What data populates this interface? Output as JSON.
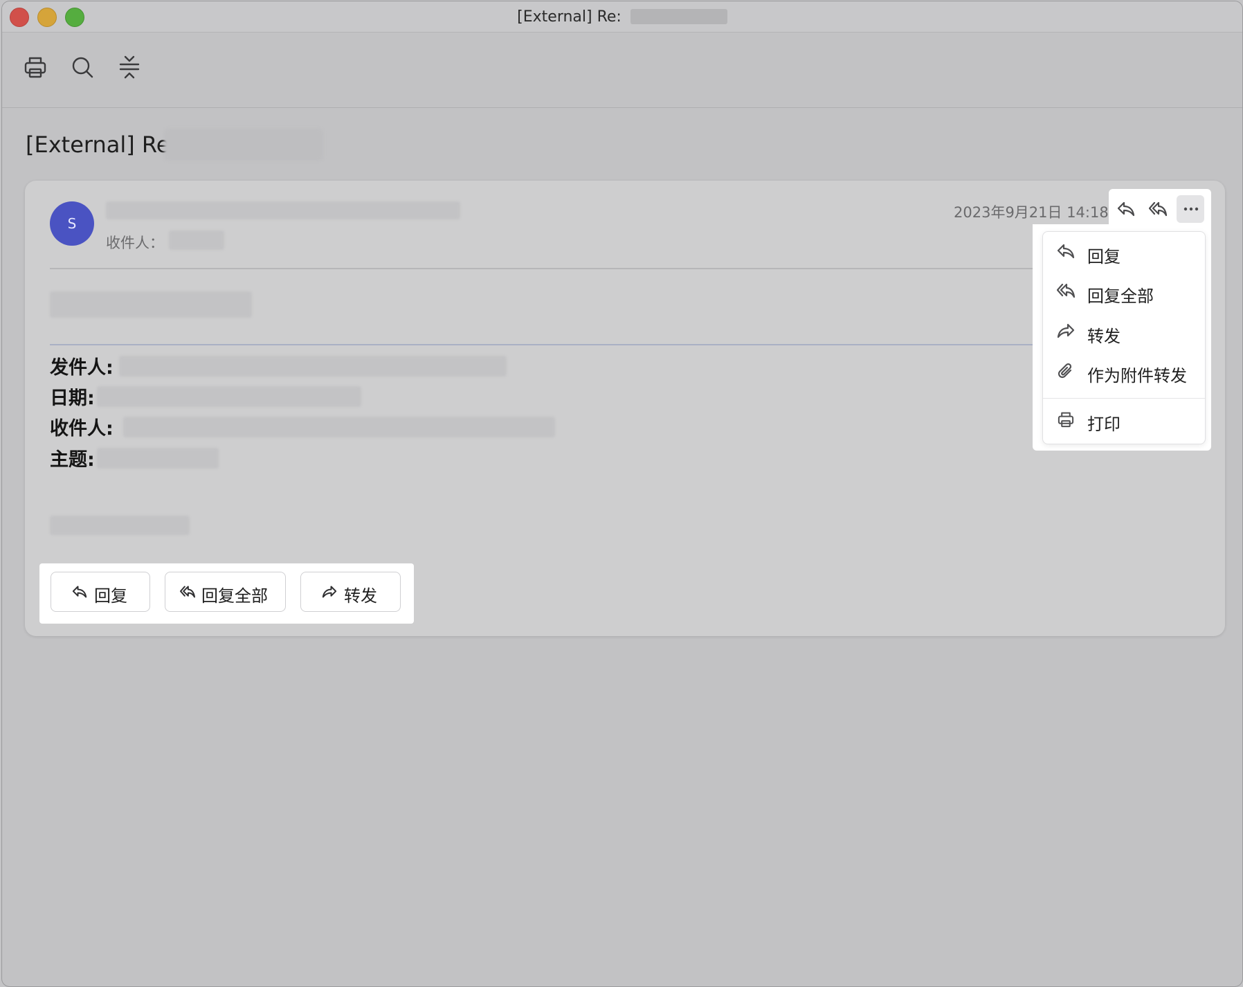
{
  "window": {
    "title": "[External] Re: "
  },
  "toolbar": {
    "icons": [
      "print-icon",
      "search-icon",
      "collapse-icon"
    ]
  },
  "email": {
    "subject": "[External] Re:",
    "avatar_letter": "S",
    "to_label": "收件人：",
    "date": "2023年9月21日 14:18",
    "quoted": {
      "from_label": "发件人:",
      "date_label": "日期:",
      "to_label": "收件人:",
      "subject_label": "主题:"
    }
  },
  "header_actions": {
    "icons": [
      "reply-icon",
      "reply-all-icon",
      "more-icon"
    ]
  },
  "menu": {
    "items": [
      {
        "label": "回复",
        "icon": "reply-icon"
      },
      {
        "label": "回复全部",
        "icon": "reply-all-icon"
      },
      {
        "label": "转发",
        "icon": "forward-icon"
      },
      {
        "label": "作为附件转发",
        "icon": "attachment-icon"
      },
      {
        "label": "打印",
        "icon": "print-icon"
      }
    ]
  },
  "buttons": {
    "reply": "回复",
    "reply_all": "回复全部",
    "forward": "转发"
  },
  "colors": {
    "avatar": "#4a53c2",
    "overlay_bg": "#c2c2c4",
    "highlight": "#ffffff"
  }
}
